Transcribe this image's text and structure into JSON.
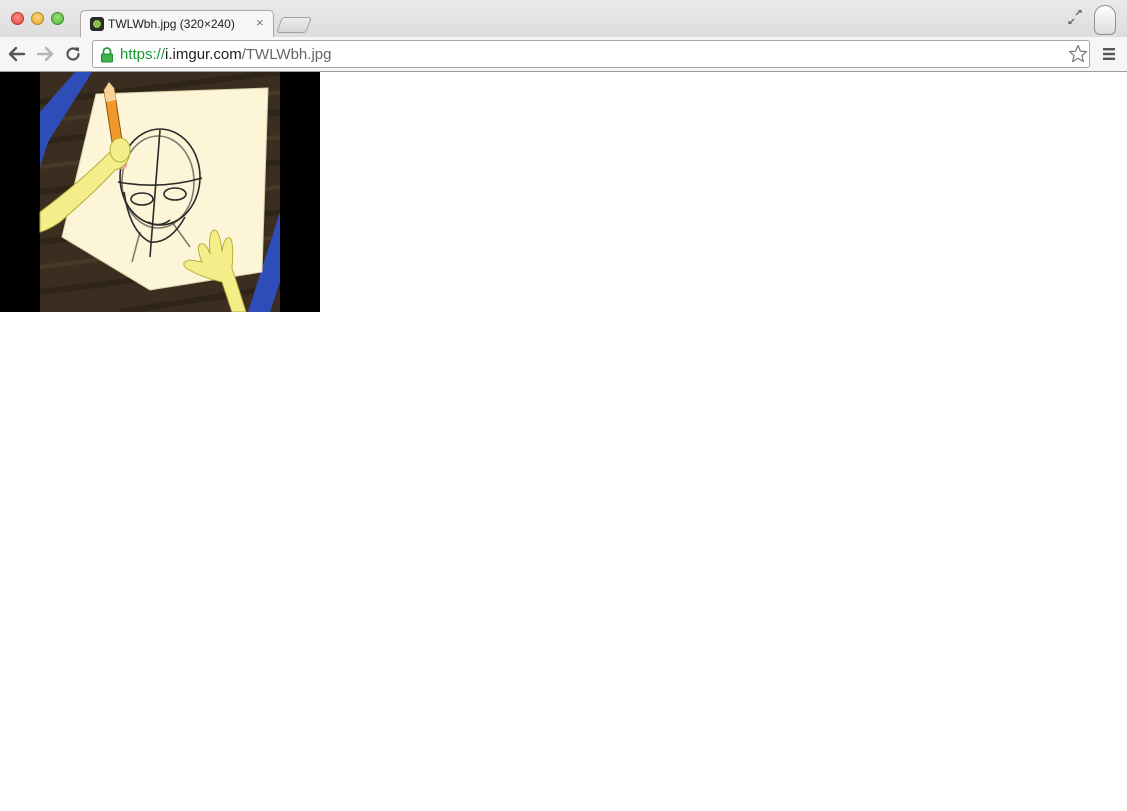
{
  "window": {
    "tab": {
      "title": "TWLWbh.jpg (320×240)",
      "close_glyph": "×",
      "favicon": "imgur-favicon-icon"
    },
    "controls": [
      "close-window-button",
      "minimize-window-button",
      "zoom-window-button"
    ]
  },
  "toolbar": {
    "url": {
      "scheme": "https://",
      "host": "i.imgur.com",
      "path": "/TWLWbh.jpg"
    },
    "icons": [
      "back-icon",
      "forward-icon",
      "reload-icon",
      "lock-icon",
      "star-icon",
      "menu-icon"
    ]
  },
  "page": {
    "image": {
      "dimensions": "320×240"
    }
  },
  "colors": {
    "secure_green": "#1a9a32",
    "tab_bg": "#f6f6f6",
    "chrome_bg": "#d2d2d2"
  }
}
